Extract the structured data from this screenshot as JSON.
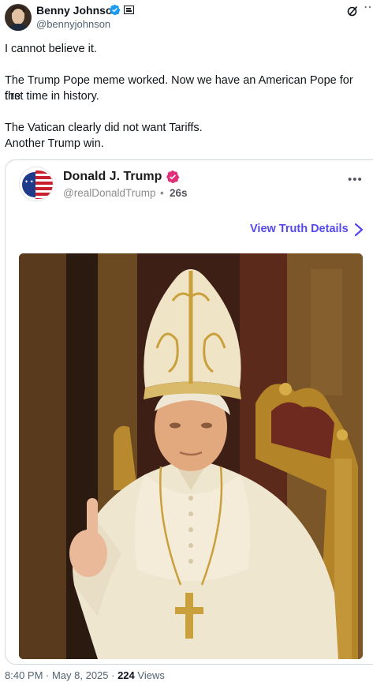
{
  "author": {
    "name": "Benny Johnson",
    "handle": "@bennyjohnson"
  },
  "body": {
    "lines": [
      "I cannot believe it.",
      "The Trump Pope meme worked. Now we have an American Pope for the",
      "first time in history.",
      "The Vatican clearly did not want Tariffs.",
      "Another Trump win."
    ]
  },
  "quoted_post": {
    "name": "Donald J. Trump",
    "handle": "@realDonaldTrump",
    "separator": "•",
    "time": "26s",
    "more": "•••",
    "link_label": "View Truth Details"
  },
  "footer": {
    "time": "8:40 PM · May 8, 2025 · ",
    "views_count": "224",
    "views_label": "Views"
  },
  "colors": {
    "verified": "#1d9bf0",
    "truth_badge": "#e0307a",
    "link": "#5448ee",
    "secondary_text": "#536471"
  },
  "icons": {
    "verified": "verified-badge-icon",
    "affiliation": "affiliation-icon",
    "grok": "grok-icon",
    "more": "more-options-icon",
    "chevron": "chevron-right-icon"
  }
}
